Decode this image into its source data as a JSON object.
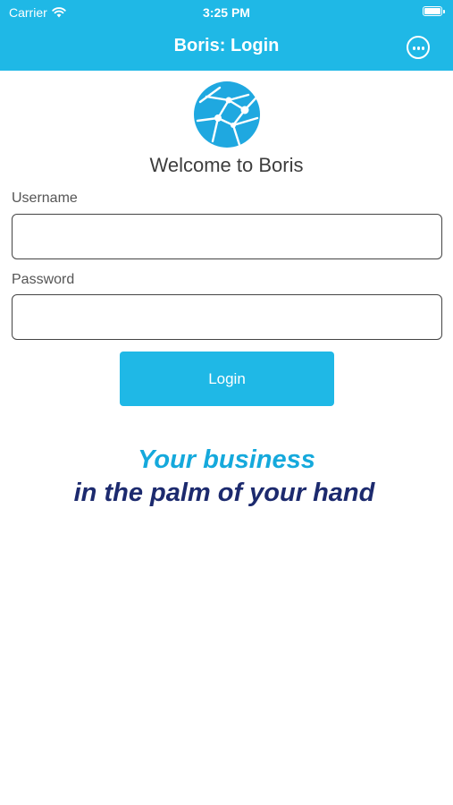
{
  "status_bar": {
    "carrier": "Carrier",
    "time": "3:25 PM",
    "wifi_icon": "wifi-icon",
    "battery_icon": "battery-icon"
  },
  "nav": {
    "title": "Boris: Login",
    "more_icon": "more-options-icon"
  },
  "logo": {
    "icon": "globe-network-logo"
  },
  "welcome": "Welcome to Boris",
  "form": {
    "username_label": "Username",
    "username_value": "",
    "password_label": "Password",
    "password_value": "",
    "login_label": "Login"
  },
  "tagline": {
    "line1": "Your business",
    "line2": "in the palm of your hand"
  },
  "colors": {
    "accent": "#1fb8e6",
    "tagline_light": "#15a9dc",
    "tagline_dark": "#1c2a6e"
  }
}
